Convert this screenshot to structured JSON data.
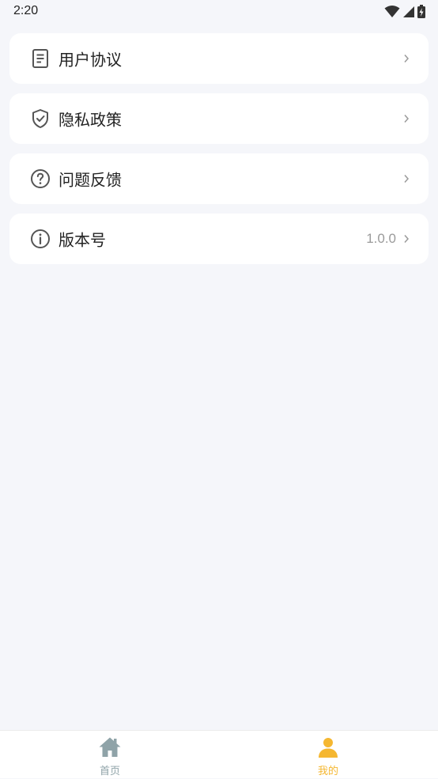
{
  "status_bar": {
    "time": "2:20"
  },
  "menu": {
    "items": [
      {
        "label": "用户协议",
        "icon": "document-icon",
        "value": ""
      },
      {
        "label": "隐私政策",
        "icon": "shield-check-icon",
        "value": ""
      },
      {
        "label": "问题反馈",
        "icon": "question-circle-icon",
        "value": ""
      },
      {
        "label": "版本号",
        "icon": "info-circle-icon",
        "value": "1.0.0"
      }
    ]
  },
  "tab_bar": {
    "tabs": [
      {
        "label": "首页",
        "icon": "home-icon",
        "active": false
      },
      {
        "label": "我的",
        "icon": "user-icon",
        "active": true
      }
    ]
  },
  "colors": {
    "background": "#f5f6fa",
    "accent": "#f5b731",
    "inactive_tab": "#8fa3a8",
    "card": "#ffffff"
  }
}
